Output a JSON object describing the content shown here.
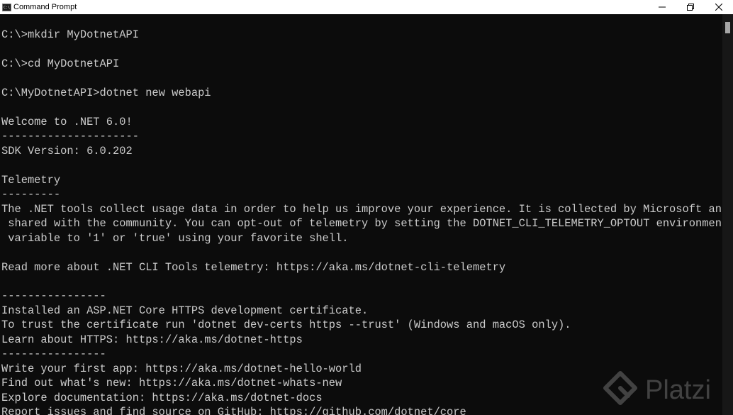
{
  "window": {
    "title": "Command Prompt",
    "icon": "cmd-icon",
    "icon_text": "C:\\"
  },
  "controls": {
    "minimize": "minimize-icon",
    "maximize": "restore-icon",
    "close": "close-icon"
  },
  "console": {
    "lines": [
      "C:\\>mkdir MyDotnetAPI",
      "",
      "C:\\>cd MyDotnetAPI",
      "",
      "C:\\MyDotnetAPI>dotnet new webapi",
      "",
      "Welcome to .NET 6.0!",
      "---------------------",
      "SDK Version: 6.0.202",
      "",
      "Telemetry",
      "---------",
      "The .NET tools collect usage data in order to help us improve your experience. It is collected by Microsoft and",
      " shared with the community. You can opt-out of telemetry by setting the DOTNET_CLI_TELEMETRY_OPTOUT environment",
      " variable to '1' or 'true' using your favorite shell.",
      "",
      "Read more about .NET CLI Tools telemetry: https://aka.ms/dotnet-cli-telemetry",
      "",
      "----------------",
      "Installed an ASP.NET Core HTTPS development certificate.",
      "To trust the certificate run 'dotnet dev-certs https --trust' (Windows and macOS only).",
      "Learn about HTTPS: https://aka.ms/dotnet-https",
      "----------------",
      "Write your first app: https://aka.ms/dotnet-hello-world",
      "Find out what's new: https://aka.ms/dotnet-whats-new",
      "Explore documentation: https://aka.ms/dotnet-docs",
      "Report issues and find source on GitHub: https://github.com/dotnet/core"
    ]
  },
  "watermark": {
    "text": "Platzi",
    "icon": "platzi-logo-icon"
  },
  "colors": {
    "console_background": "#0c0c0c",
    "console_text": "#cccccc",
    "titlebar_background": "#ffffff"
  }
}
